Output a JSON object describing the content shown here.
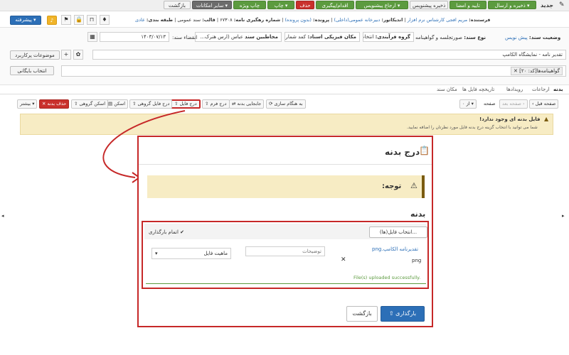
{
  "toolbar": {
    "title": "جدید",
    "save_send": "ذخیره و ارسال",
    "approve_sign": "تایید و امضا",
    "save_draft": "ذخیره پیشنویس",
    "refer_draft": "ارجاع پیشنویس",
    "action_followup": "اقدام/پیگیری",
    "delete": "حذف",
    "print": "چاپ",
    "print_special": "چاپ ویژه",
    "other_options": "سایر امکانات",
    "back": "بازگشت",
    "advanced": "پیشرفته"
  },
  "header": {
    "sender_label": "فرستنده:",
    "sender_value": "مریم افجی کارشناس نرم افزار",
    "indicator_label": "اندیکاتور:",
    "indicator_value": "دبیرخانه عمومی(داخلی)",
    "file_label": "پرونده:",
    "file_value": "(بدون پرونده)",
    "tracking_label": "شماره رهگیری نامه:",
    "tracking_value": "۶۷۳۰۸",
    "template_label": "قالب:",
    "template_value": "سند عمومی",
    "class_label": "طبقه بندی:",
    "class_value": "عادی"
  },
  "form": {
    "status_label": "وضعیت سند:",
    "status_value": "پیش نویس",
    "doctype_label": "نوع سند:",
    "doctype_value": "صورتجلسه و گواهینامه",
    "process_label": "گروه فرآیندی:",
    "process_value": "انتخاب نشده",
    "physical_label": "مکان فیزیکی اسناد:",
    "physical_value": "کمد شماره۲",
    "audience_label": "مخاطبین سند",
    "audience_value": "عباس (ارس هنرک...",
    "expire_label": "انقضاء سند:",
    "expire_value": "۱۴۰۳/۰۷/۱۳",
    "subject_value": "تقدیر نامه - نمایشگاه الکامپ",
    "topics_button": "موضوعات پرکاربرد",
    "archive_button": "انتخاب بایگانی",
    "archive_chip": "گواهینامه‌ها[کد: ۲۰]"
  },
  "tabs": [
    "بدنه",
    "ارجاعات",
    "رویدادها",
    "تاریخچه فایل ها",
    "مکان سند"
  ],
  "body_toolbar": {
    "prev_page": "صفحه قبل",
    "next_page": "صفحه بعد",
    "page_label": "صفحه",
    "page_of": "از ۰",
    "sync": "به هنگام سازی",
    "move_body": "جابجایی بدنه",
    "insert_form": "درج فرم",
    "insert_file": "درج فایل",
    "insert_group": "درج فایل گروهی",
    "scan": "اسکن",
    "scan_group": "اسکن گروهی",
    "delete_body": "حذف بدنه",
    "more": "بیشتر"
  },
  "notice": {
    "title": "فایل بدنه ای وجود ندارد!",
    "text": "شما می توانید با انتخاب گزینه درج بدنه فایل مورد نظرتان را اضافه نمایید."
  },
  "modal": {
    "title": "درج بدنه",
    "warning": "توجه:",
    "section": "بدنه",
    "choose_files": "انتخاب فایل(ها)...",
    "upload_done": "اتمام بارگذاری",
    "file_name": "png.تقدیرنامه الکامپ",
    "file_ext": "png",
    "description_placeholder": "توضیحات",
    "file_nature": "ماهیت فایل",
    "success": "File(s) uploaded successfully.",
    "upload_button": "بارگذاری",
    "back_button": "بازگشت"
  },
  "colors": {
    "highlight": "#c62828",
    "warning_bg": "#f7ecc4",
    "success": "#5c9b3f",
    "accent": "#2c6fb7"
  }
}
